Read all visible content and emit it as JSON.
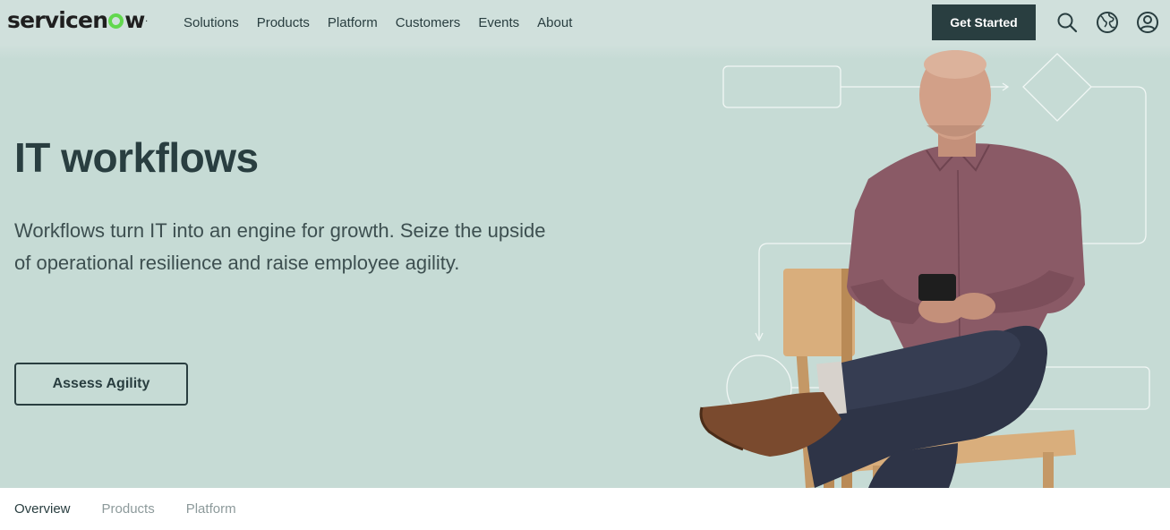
{
  "brand": {
    "logo_before": "servicen",
    "logo_after": "w",
    "trademark": "."
  },
  "nav": {
    "links": [
      "Solutions",
      "Products",
      "Platform",
      "Customers",
      "Events",
      "About"
    ],
    "cta_label": "Get Started",
    "icons": [
      "search-icon",
      "globe-icon",
      "user-icon"
    ]
  },
  "hero": {
    "title": "IT workflows",
    "description": "Workflows turn IT into an engine for growth. Seize the upside of operational resilience and raise employee agility.",
    "button_label": "Assess Agility"
  },
  "subnav": {
    "items": [
      "Overview",
      "Products",
      "Platform"
    ],
    "active": "Overview"
  },
  "colors": {
    "dark": "#293e40",
    "hero_bg": "#c6dbd5",
    "nav_bg": "#d0e0dc",
    "accent_green": "#62d84e"
  }
}
